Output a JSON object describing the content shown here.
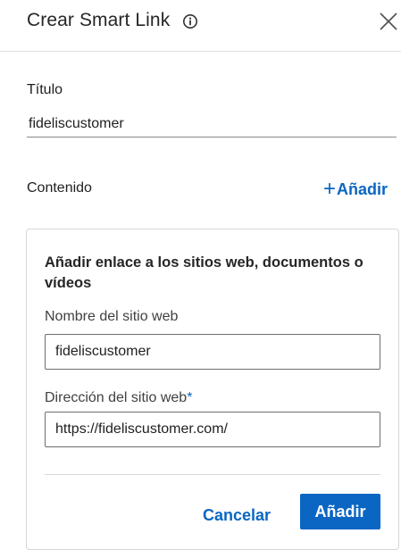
{
  "dialog": {
    "title": "Crear Smart Link",
    "info_icon": "info-icon",
    "close_icon": "close-icon"
  },
  "title_section": {
    "label": "Título",
    "value": "fideliscustomer"
  },
  "content_section": {
    "label": "Contenido",
    "add_plus": "+",
    "add_label": "Añadir"
  },
  "link_card": {
    "heading": "Añadir enlace a los sitios web, documentos o vídeos",
    "site_name_label": "Nombre del sitio web",
    "site_name_value": "fideliscustomer",
    "site_url_label": "Dirección del sitio web",
    "required_marker": "*",
    "site_url_value": "https://fideliscustomer.com/",
    "cancel_label": "Cancelar",
    "submit_label": "Añadir"
  },
  "colors": {
    "accent": "#0a66c2",
    "text": "#1f1f1f",
    "border": "#d6d6d6"
  }
}
